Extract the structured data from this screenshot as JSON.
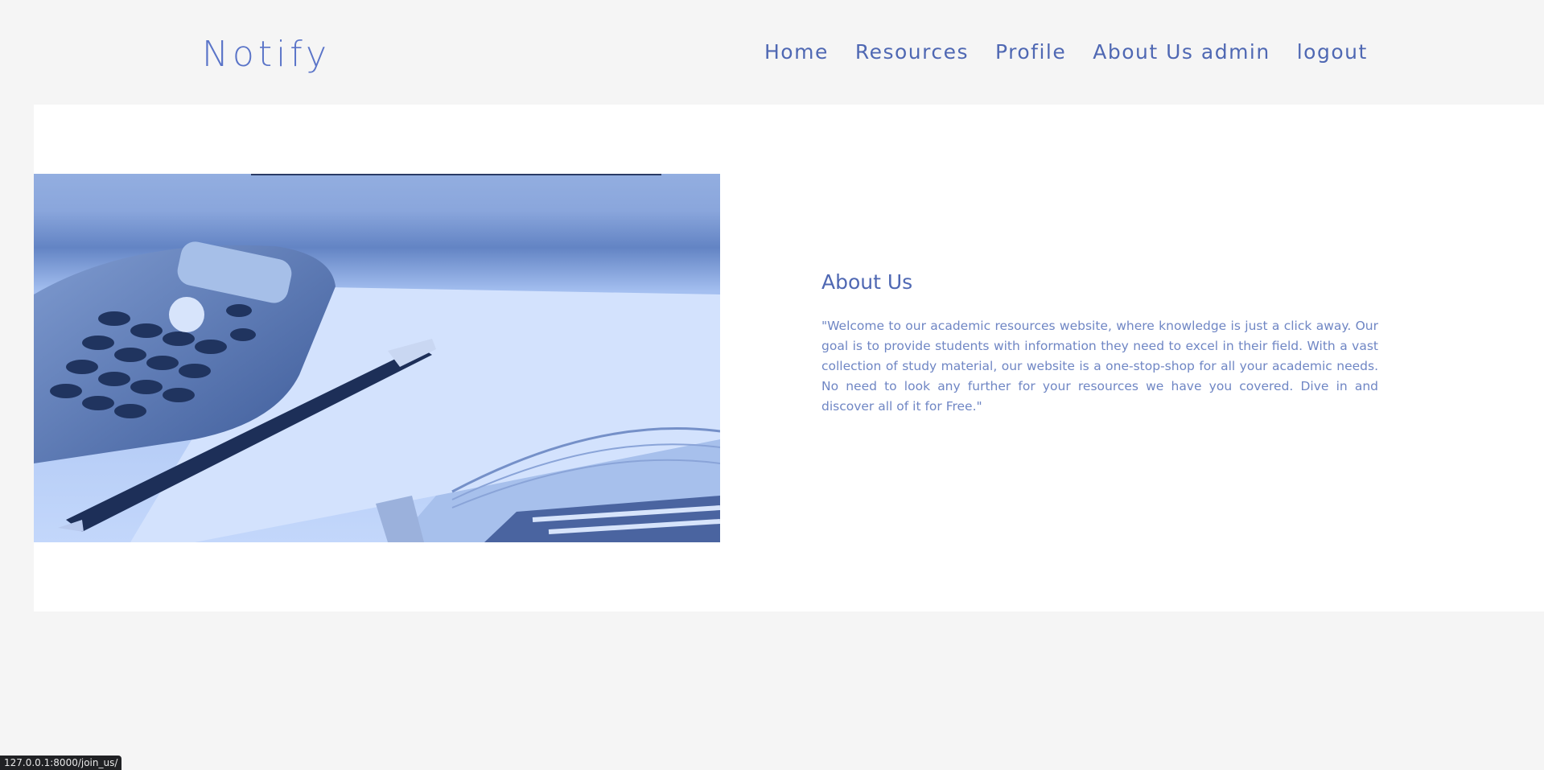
{
  "header": {
    "brand": "Notify",
    "nav": [
      {
        "label": "Home"
      },
      {
        "label": "Resources"
      },
      {
        "label": "Profile"
      },
      {
        "label": "About Us admin"
      },
      {
        "label": "logout"
      }
    ]
  },
  "about": {
    "title": "About Us",
    "body": "\"Welcome to our academic resources website, where knowledge is just a click away. Our goal is to provide students with information they need to excel in their field. With a vast collection of study material, our website is a one-stop-shop for all your academic needs. No need to look any further for your resources we have you covered. Dive in and discover all of it for Free.\""
  },
  "status": {
    "url": "127.0.0.1:8000/join_us/"
  },
  "colors": {
    "brand": "#5a74c8",
    "nav": "#4f68b3",
    "text": "#6f86c4",
    "background": "#f5f5f5",
    "panel": "#ffffff"
  }
}
